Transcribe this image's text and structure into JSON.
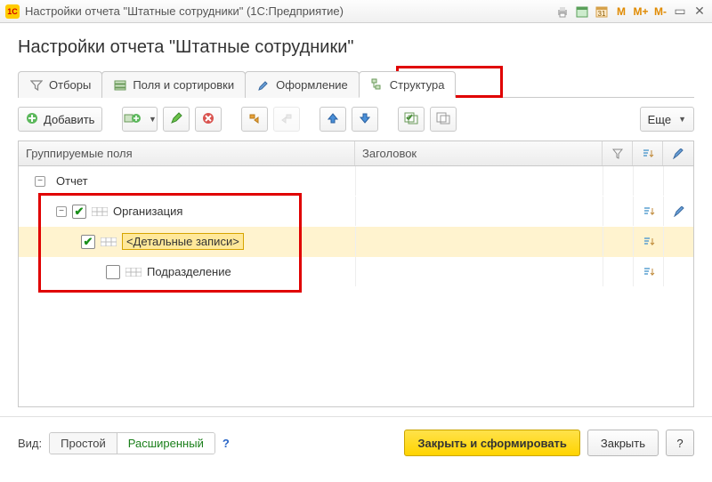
{
  "window": {
    "title": "Настройки отчета \"Штатные сотрудники\"  (1С:Предприятие)",
    "app_badge": "1C"
  },
  "header": {
    "title": "Настройки отчета \"Штатные сотрудники\""
  },
  "tabs": {
    "filters": "Отборы",
    "fields": "Поля и сортировки",
    "formatting": "Оформление",
    "structure": "Структура"
  },
  "toolbar": {
    "add": "Добавить",
    "more": "Еще"
  },
  "grid": {
    "col_groups": "Группируемые поля",
    "col_title": "Заголовок"
  },
  "tree": {
    "report": "Отчет",
    "org": "Организация",
    "details": "<Детальные записи>",
    "division": "Подразделение"
  },
  "footer": {
    "view_label": "Вид:",
    "simple": "Простой",
    "advanced": "Расширенный",
    "help": "?",
    "apply": "Закрыть и сформировать",
    "close": "Закрыть",
    "help2": "?"
  },
  "colors": {
    "highlight": "#e00000",
    "accent": "#ffd400"
  }
}
